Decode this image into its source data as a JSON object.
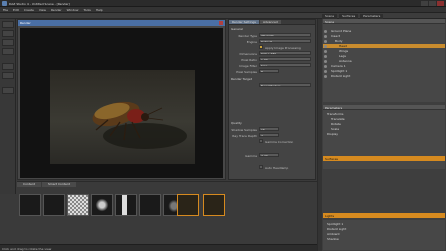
{
  "window": {
    "title": "DAZ Studio 4 - Untitled Scene - [Render]"
  },
  "menubar": {
    "items": [
      "File",
      "Edit",
      "Create",
      "View",
      "Render",
      "Window",
      "Tools",
      "Help"
    ]
  },
  "toolbar": {
    "right_tabs": [
      "Scene",
      "Surfaces",
      "Parameters"
    ]
  },
  "render_window": {
    "title": "Render"
  },
  "attr_panel": {
    "tabs": [
      "Render Settings",
      "Advanced"
    ],
    "section_general": "General",
    "rows": [
      {
        "label": "Render Type",
        "value": "3Delight"
      },
      {
        "label": "Engine",
        "value": "Default"
      },
      {
        "label": "Dimensions",
        "value": "640 x 480"
      },
      {
        "label": "Pixel Ratio",
        "value": "1.00"
      },
      {
        "label": "Image Filter",
        "value": "Sinc"
      },
      {
        "label": "Pixel Samples",
        "value": "8"
      }
    ],
    "check_label": "Apply Image Processing",
    "section_render": "Render Target",
    "render_target_value": "New Window",
    "section_quality": "Quality",
    "quality_rows": [
      {
        "label": "Shadow Samples",
        "value": "16"
      },
      {
        "label": "Ray Trace Depth",
        "value": "2"
      },
      {
        "label": "Gamma",
        "value": "2.20"
      }
    ],
    "check2_label": "Gamma Correction",
    "check3_label": "Auto Headlamp"
  },
  "scene_panel": {
    "header": "Scene",
    "items": [
      {
        "name": "Ground Plane",
        "indent": 8,
        "selected": false
      },
      {
        "name": "Insect",
        "indent": 8,
        "selected": false
      },
      {
        "name": "Body",
        "indent": 12,
        "selected": false
      },
      {
        "name": "Head",
        "indent": 16,
        "selected": true
      },
      {
        "name": "Wings",
        "indent": 16,
        "selected": false
      },
      {
        "name": "Legs",
        "indent": 16,
        "selected": false
      },
      {
        "name": "Antenna",
        "indent": 16,
        "selected": false
      },
      {
        "name": "Camera 1",
        "indent": 8,
        "selected": false
      },
      {
        "name": "Spotlight 1",
        "indent": 8,
        "selected": false
      },
      {
        "name": "Distant Light",
        "indent": 8,
        "selected": false
      }
    ],
    "params_header": "Parameters",
    "param_items": [
      "Transforms",
      "Translate",
      "Rotate",
      "Scale",
      "Display"
    ],
    "orange_bar_1": "Surfaces",
    "orange_bar_2": "Lights",
    "bottom_items": [
      "Spotlight 1",
      "Distant Light",
      "Ambient",
      "Shadow"
    ]
  },
  "filmstrip": {
    "tabs": [
      "Content",
      "Smart Content"
    ],
    "thumb_count": 9,
    "selected_indices": [
      7,
      8
    ]
  },
  "status": {
    "text": "Click and drag to rotate the view"
  }
}
